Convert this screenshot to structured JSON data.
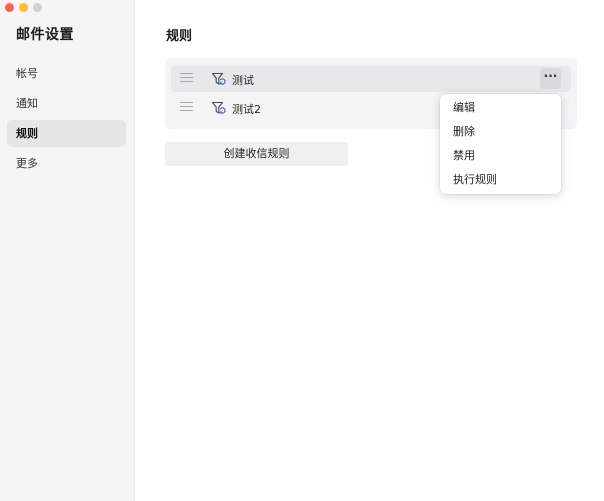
{
  "sidebar": {
    "title": "邮件设置",
    "items": [
      {
        "label": "帐号",
        "active": false
      },
      {
        "label": "通知",
        "active": false
      },
      {
        "label": "规则",
        "active": true
      },
      {
        "label": "更多",
        "active": false
      }
    ]
  },
  "main": {
    "title": "规则",
    "rules": [
      {
        "name": "测试",
        "icon": "filter-rule-icon"
      },
      {
        "name": "测试2",
        "icon": "filter-rule-icon"
      }
    ],
    "more_label": "···",
    "create_label": "创建收信规则"
  },
  "context_menu": {
    "items": [
      {
        "label": "编辑"
      },
      {
        "label": "删除"
      },
      {
        "label": "禁用"
      },
      {
        "label": "执行规则"
      }
    ]
  },
  "colors": {
    "close": "#fe5f57",
    "minimize": "#febc2e",
    "maximize": "#d0d0d0",
    "accent_blue": "#2f6fd6",
    "icon_gray": "#4a4a4a"
  }
}
